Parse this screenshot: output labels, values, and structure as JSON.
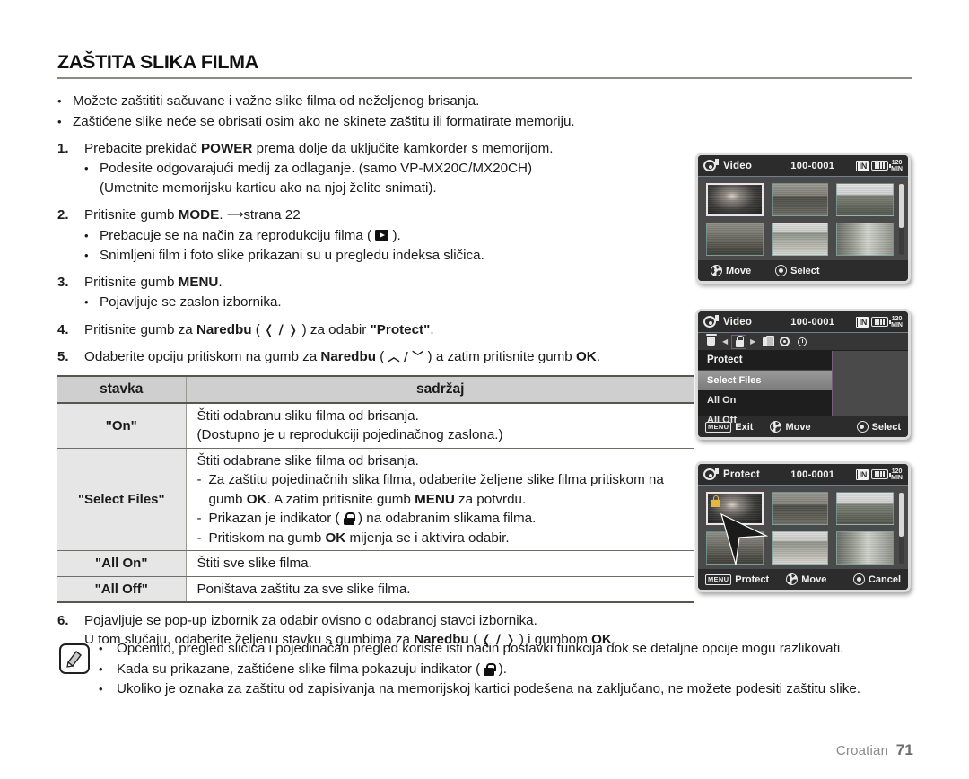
{
  "page": {
    "title": "ZAŠTITA SLIKA FILMA",
    "footer_label": "Croatian_",
    "footer_page": "71"
  },
  "intro_bullets": [
    "Možete zaštititi sačuvane i važne slike filma od neželjenog brisanja.",
    "Zaštićene slike neće se obrisati osim ako ne skinete zaštitu ili formatirate memoriju."
  ],
  "steps": {
    "s1": {
      "num": "1.",
      "text_pre": "Prebacite prekidač ",
      "bold": "POWER",
      "text_post": " prema dolje da uključite kamkorder s memorijom.",
      "subs": [
        "Podesite odgovarajući medij za odlaganje. (samo VP-MX20C/MX20CH)",
        "(Umetnite memorijsku karticu ako na njoj želite snimati)."
      ]
    },
    "s2": {
      "num": "2.",
      "text_pre": "Pritisnite gumb ",
      "bold": "MODE",
      "text_post": ". ",
      "page_ref": "strana 22",
      "sub1_pre": "Prebacuje se na način za reprodukciju filma ( ",
      "sub1_post": " ).",
      "sub2": "Snimljeni film i foto slike prikazani su u pregledu indeksa sličica."
    },
    "s3": {
      "num": "3.",
      "text_pre": "Pritisnite gumb ",
      "bold": "MENU",
      "text_post": ".",
      "sub1": "Pojavljuje se zaslon izbornika."
    },
    "s4": {
      "num": "4.",
      "text_pre": "Pritisnite gumb za ",
      "bold": "Naredbu",
      "glyph": "❬ / ❭",
      "text_mid": " za odabir ",
      "bold2": "\"Protect\"",
      "text_post": "."
    },
    "s5": {
      "num": "5.",
      "text_pre": "Odaberite opciju pritiskom na gumb za ",
      "bold": "Naredbu",
      "glyph": "︿ / ﹀",
      "text_mid": " a zatim pritisnite gumb ",
      "bold2": "OK",
      "text_post": "."
    },
    "s6": {
      "num": "6.",
      "line1": "Pojavljuje se pop-up izbornik za odabir ovisno o odabranoj stavci izbornika.",
      "line2_pre": "U tom slučaju, odaberite željenu stavku s gumbima za ",
      "bold": "Naredbu",
      "glyph": "❬ / ❭",
      "line2_mid": " i gumbom ",
      "bold2": "OK",
      "line2_post": "."
    }
  },
  "table": {
    "headers": [
      "stavka",
      "sadržaj"
    ],
    "rows": [
      {
        "item": "\"On\"",
        "lines": [
          "Štiti odabranu sliku filma od brisanja.",
          "(Dostupno je u reprodukciji pojedinačnog zaslona.)"
        ],
        "dashes": []
      },
      {
        "item": "\"Select Files\"",
        "lines": [
          "Štiti odabrane slike filma od brisanja."
        ],
        "dashes": [
          {
            "pre": "Za zaštitu pojedinačnih slika filma, odaberite željene slike filma pritiskom na gumb ",
            "b1": "OK",
            "mid": ". A zatim pritisnite gumb ",
            "b2": "MENU",
            "post": " za potvrdu."
          },
          {
            "pre": "Prikazan je indikator ( ",
            "b1": "",
            "mid": "",
            "b2": "",
            "post": " ) na odabranim slikama filma.",
            "lock": true
          },
          {
            "pre": "Pritiskom na gumb ",
            "b1": "OK",
            "mid": " mijenja se i aktivira odabir.",
            "b2": "",
            "post": ""
          }
        ]
      },
      {
        "item": "\"All On\"",
        "lines": [
          "Štiti sve slike filma."
        ],
        "dashes": []
      },
      {
        "item": "\"All Off\"",
        "lines": [
          "Poništava zaštitu za sve slike filma."
        ],
        "dashes": []
      }
    ]
  },
  "notes": [
    {
      "text": "Općenito, pregled sličica i pojedinačan pregled koriste isti način postavki funkcija dok se detaljne opcije mogu razlikovati."
    },
    {
      "pre": "Kada su prikazane, zaštićene slike filma pokazuju indikator ( ",
      "post": " ).",
      "lock": true
    },
    {
      "text": "Ukoliko je oznaka za zaštitu od zapisivanja na memorijskoj kartici podešena na zaključano, ne možete podesiti zaštitu slike."
    }
  ],
  "lcd1": {
    "mode_icon": "video-reel-icon",
    "title": "Video",
    "file_number": "100-0001",
    "storage_badge": "IN",
    "battery_icon": "battery-full-icon",
    "minutes": "120",
    "minutes_unit": "MIN",
    "hints": [
      {
        "icon": "joystick-icon",
        "label": "Move"
      },
      {
        "icon": "ok-button-icon",
        "label": "Select"
      }
    ]
  },
  "lcd2": {
    "mode_icon": "video-reel-icon",
    "title": "Video",
    "file_number": "100-0001",
    "storage_badge": "IN",
    "battery_icon": "battery-full-icon",
    "minutes": "120",
    "minutes_unit": "MIN",
    "tabs": [
      "trash-icon",
      "lock-icon",
      "copy-icon",
      "gear-icon",
      "clock-icon"
    ],
    "menu_title": "Protect",
    "menu_items": [
      "Select Files",
      "All On",
      "All Off"
    ],
    "selected_item": "Select Files",
    "hints": [
      {
        "icon": "menu-button-icon",
        "label": "Exit"
      },
      {
        "icon": "joystick-icon",
        "label": "Move"
      },
      {
        "icon": "ok-button-icon",
        "label": "Select"
      }
    ]
  },
  "lcd3": {
    "mode_icon": "video-reel-icon",
    "title": "Protect",
    "file_number": "100-0001",
    "storage_badge": "IN",
    "battery_icon": "battery-full-icon",
    "minutes": "120",
    "minutes_unit": "MIN",
    "protected_indicator": "lock-icon",
    "hints": [
      {
        "icon": "menu-button-icon",
        "label": "Protect"
      },
      {
        "icon": "joystick-icon",
        "label": "Move"
      },
      {
        "icon": "ok-button-icon",
        "label": "Cancel"
      }
    ]
  },
  "colors": {
    "rule": "#8a8a82",
    "table_header_bg": "#cfcfcf",
    "table_item_bg": "#e6e6e6",
    "lcd_bg": "#464646",
    "lcd_bar": "#2c2c2c",
    "menu_highlight": "#8d8d8d",
    "lock_yellow": "#e5b640",
    "footer_text": "#8b8b8b"
  }
}
